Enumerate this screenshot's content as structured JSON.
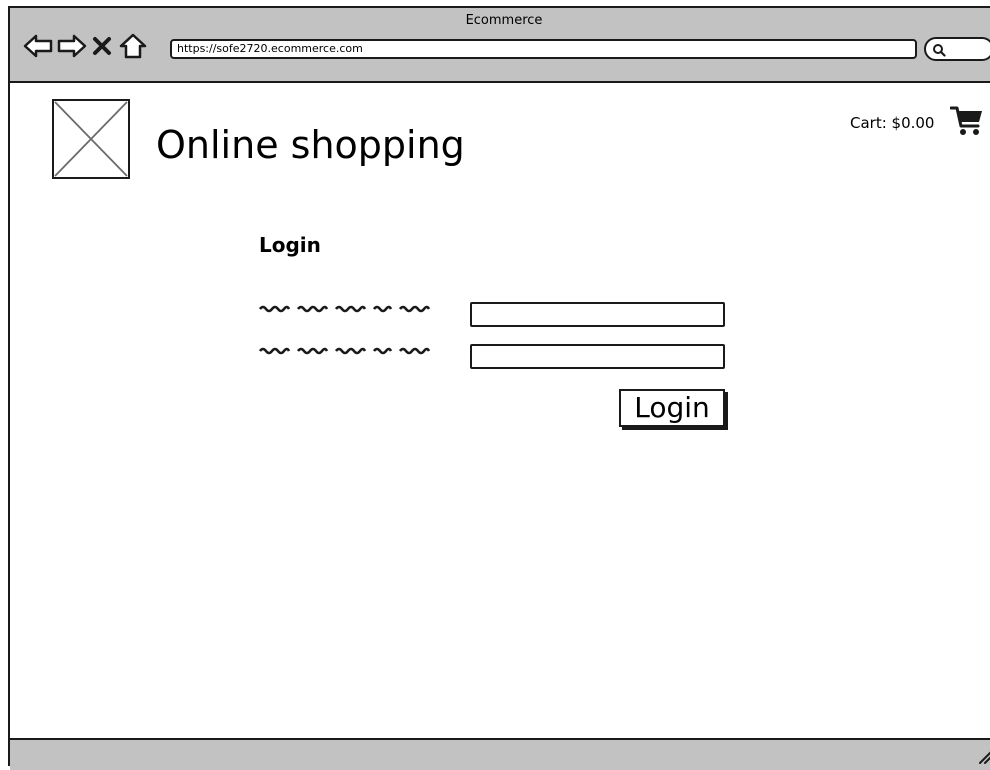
{
  "window": {
    "title": "Ecommerce"
  },
  "browser": {
    "url": "https://sofe2720.ecommerce.com",
    "nav_icons": [
      "back-arrow-icon",
      "forward-arrow-icon",
      "close-icon",
      "home-icon"
    ],
    "search_icon": "search-icon"
  },
  "header": {
    "logo": "image-placeholder",
    "site_title": "Online shopping",
    "cart_label": "Cart: $0.00",
    "cart_icon": "shopping-cart-icon"
  },
  "login": {
    "heading": "Login",
    "field_1_value": "",
    "field_2_value": "",
    "submit_label": "Login"
  },
  "colors": {
    "chrome": "#c2c2c2",
    "ink": "#1a1a1a",
    "background": "#ffffff"
  }
}
